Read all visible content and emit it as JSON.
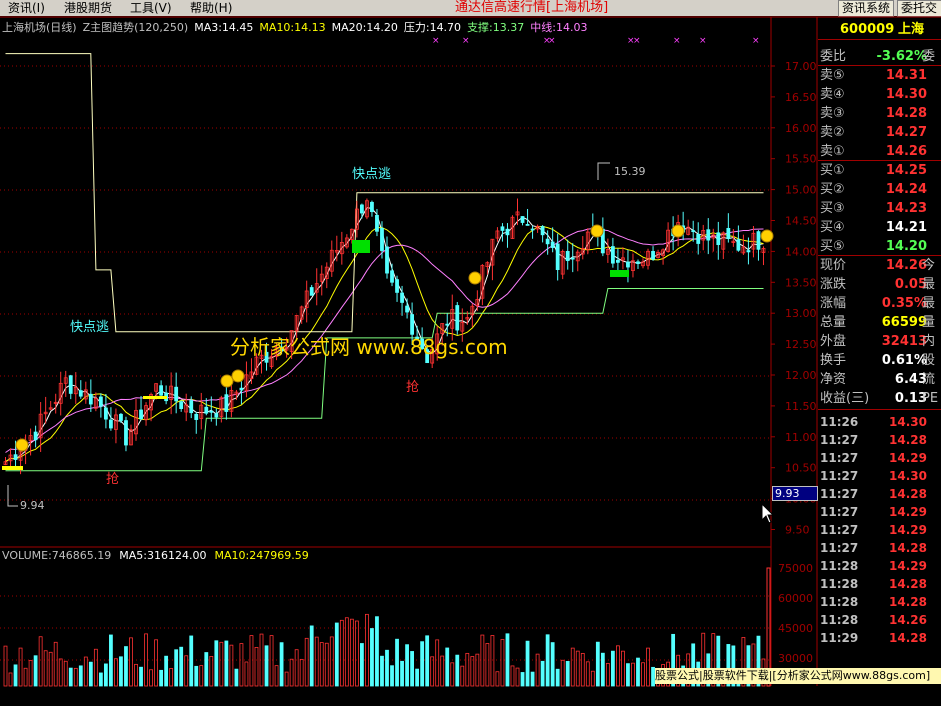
{
  "menu": {
    "items": [
      "资讯(I)",
      "港股期货",
      "工具(V)",
      "帮助(H)"
    ],
    "app_title": "通达信高速行情[上海机场]",
    "buttons": [
      "资讯系统",
      "委托交"
    ]
  },
  "chart_header": {
    "security": "上海机场(日线)",
    "indicator": "Z主图趋势(120,250)",
    "ma3": "MA3:14.45",
    "ma10": "MA10:14.13",
    "ma20": "MA20:14.20",
    "pressure": "压力:14.70",
    "support": "支撑:13.37",
    "midline": "中线:14.03"
  },
  "annotations": {
    "escape_1": "快点逃",
    "escape_2": "快点逃",
    "grab_1": "抢",
    "grab_2": "抢",
    "high_marker": "15.39",
    "low_marker": "9.94",
    "cursor_price": "9.93"
  },
  "watermark": "分析家公式网 www.88gs.com",
  "volume_header": {
    "volume": "VOLUME:746865.19",
    "ma5": "MA5:316124.00",
    "ma10": "MA10:247969.59"
  },
  "price_axis": [
    "17.00",
    "16.50",
    "16.00",
    "15.50",
    "15.00",
    "14.50",
    "14.00",
    "13.50",
    "13.00",
    "12.50",
    "12.00",
    "11.50",
    "11.00",
    "10.50",
    "10.00",
    "9.50"
  ],
  "volume_axis": [
    "75000",
    "60000",
    "45000",
    "30000"
  ],
  "quote_panel": {
    "code": "600009",
    "name": "上海",
    "webi_label": "委比",
    "webi_value": "-3.62%",
    "webi_extra": "委",
    "sell": [
      {
        "label": "卖⑤",
        "price": "14.31"
      },
      {
        "label": "卖④",
        "price": "14.30"
      },
      {
        "label": "卖③",
        "price": "14.28"
      },
      {
        "label": "卖②",
        "price": "14.27"
      },
      {
        "label": "卖①",
        "price": "14.26"
      }
    ],
    "buy": [
      {
        "label": "买①",
        "price": "14.25"
      },
      {
        "label": "买②",
        "price": "14.24"
      },
      {
        "label": "买③",
        "price": "14.23"
      },
      {
        "label": "买④",
        "price": "14.21"
      },
      {
        "label": "买⑤",
        "price": "14.20"
      }
    ],
    "stats": [
      {
        "label": "现价",
        "value": "14.26",
        "extra": "今"
      },
      {
        "label": "涨跌",
        "value": "0.05",
        "extra": "最"
      },
      {
        "label": "涨幅",
        "value": "0.35%",
        "extra": "最"
      },
      {
        "label": "总量",
        "value": "66599",
        "extra": "量"
      },
      {
        "label": "外盘",
        "value": "32413",
        "extra": "内"
      },
      {
        "label": "换手",
        "value": "0.61%",
        "extra": "股"
      },
      {
        "label": "净资",
        "value": "6.43",
        "extra": "流"
      },
      {
        "label": "收益(三)",
        "value": "0.13",
        "extra": "PE"
      }
    ],
    "ticks": [
      {
        "time": "11:26",
        "price": "14.30"
      },
      {
        "time": "11:27",
        "price": "14.28"
      },
      {
        "time": "11:27",
        "price": "14.29"
      },
      {
        "time": "11:27",
        "price": "14.30"
      },
      {
        "time": "11:27",
        "price": "14.28"
      },
      {
        "time": "11:27",
        "price": "14.29"
      },
      {
        "time": "11:27",
        "price": "14.29"
      },
      {
        "time": "11:27",
        "price": "14.28"
      },
      {
        "time": "11:28",
        "price": "14.29"
      },
      {
        "time": "11:28",
        "price": "14.28"
      },
      {
        "time": "11:28",
        "price": "14.28"
      },
      {
        "time": "11:28",
        "price": "14.26"
      },
      {
        "time": "11:29",
        "price": "14.28"
      }
    ]
  },
  "footer_banner": "股票公式|股票软件下载|[分析家公式网www.88gs.com]",
  "colors": {
    "up": "#ff3232",
    "down": "#54ffff",
    "ma3": "#ffffff",
    "ma10": "#ffff00",
    "ma20": "#ff80ff",
    "support": "#80ff80",
    "grid": "#a00000",
    "label": "#c0c0c0"
  }
}
